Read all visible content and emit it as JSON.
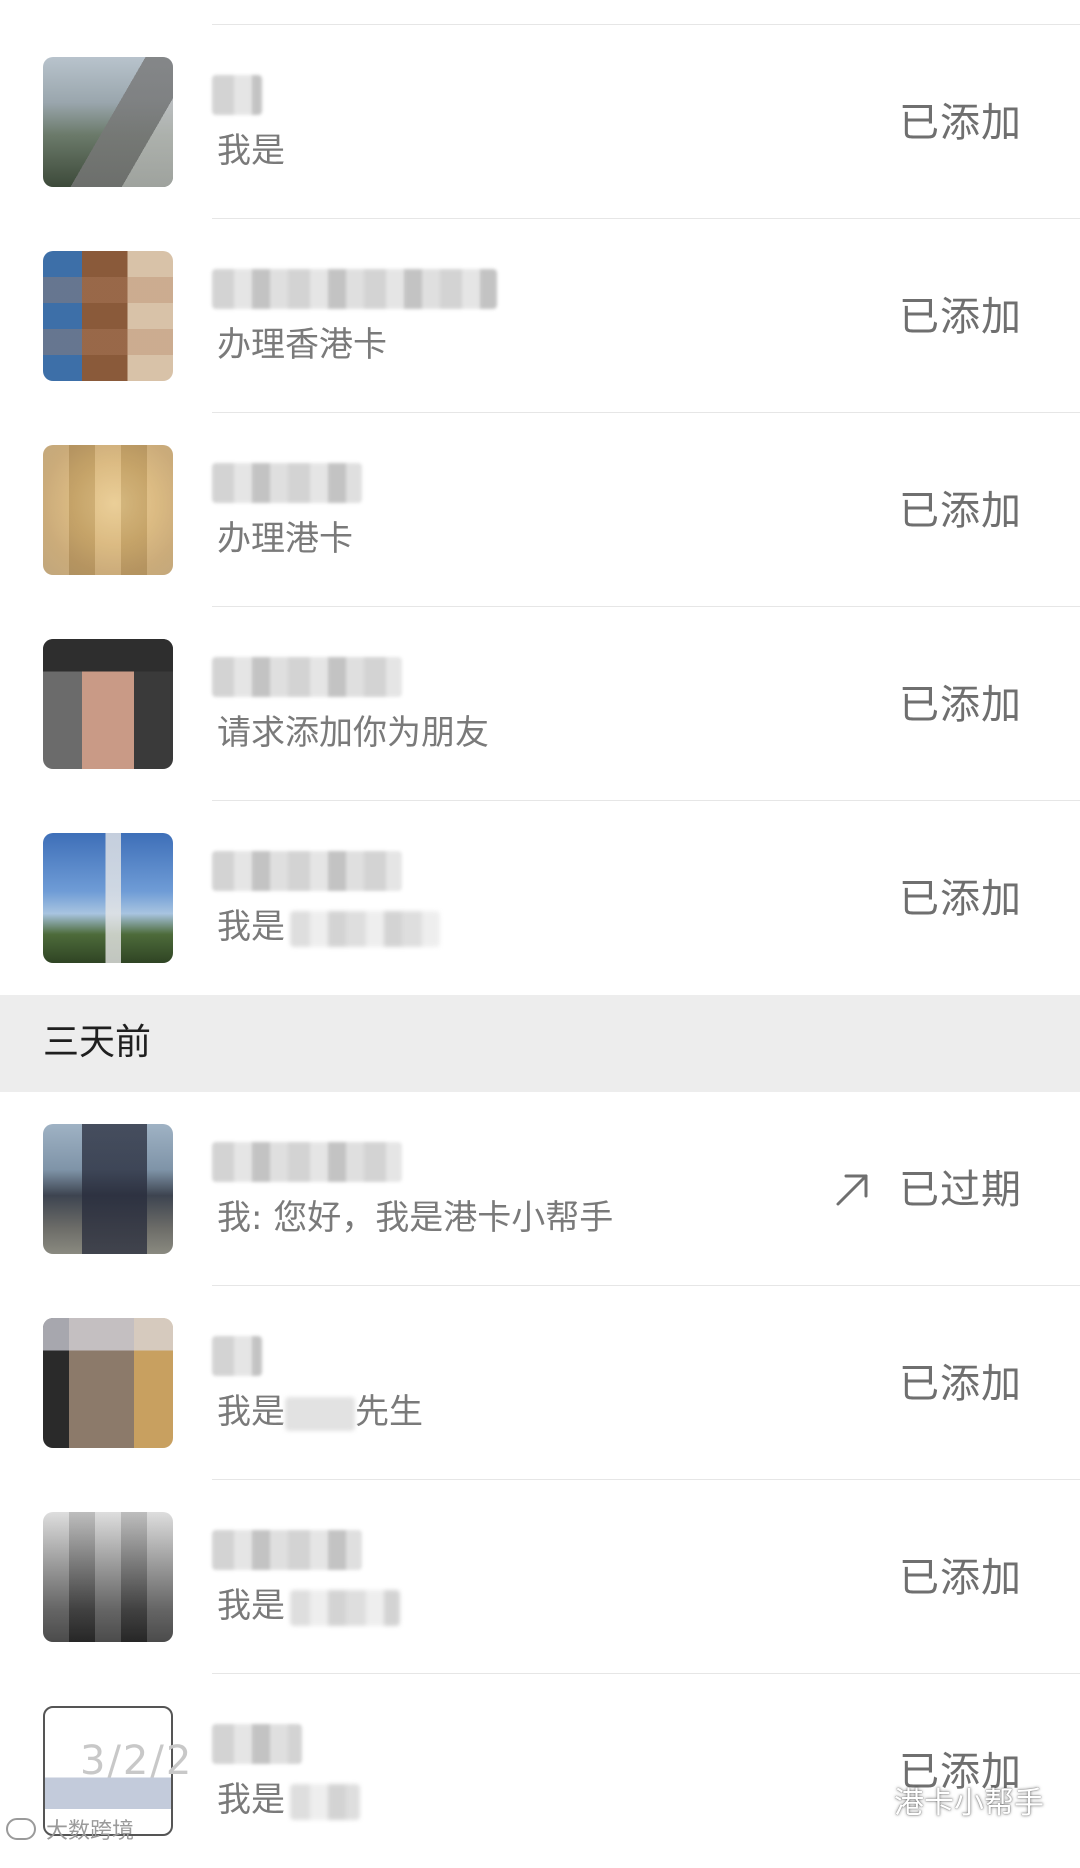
{
  "requests_recent": [
    {
      "subtitle": "我是",
      "status": "已添加",
      "name_blur_width": 50
    },
    {
      "subtitle": "办理香港卡",
      "status": "已添加",
      "name_blur_width": 285
    },
    {
      "subtitle": "办理港卡",
      "status": "已添加",
      "name_blur_width": 150
    },
    {
      "subtitle": "请求添加你为朋友",
      "status": "已添加",
      "name_blur_width": 190
    },
    {
      "subtitle": "我是",
      "status": "已添加",
      "name_blur_width": 190
    }
  ],
  "section_header": {
    "label": "三天前"
  },
  "requests_older": [
    {
      "subtitle": "我: 您好，我是港卡小帮手",
      "status": "已过期"
    },
    {
      "subtitle": "我是",
      "subtitle_suffix": "先生",
      "status": "已添加"
    },
    {
      "subtitle": "我是",
      "status": "已添加"
    },
    {
      "subtitle": "我是",
      "status": "已添加"
    }
  ],
  "icons": {
    "expired_indicator": "arrow-up-right-icon",
    "wechat_logo": "wechat-icon",
    "weibo_logo": "weibo-icon"
  },
  "watermarks": {
    "date": "3/2/2",
    "bottom_left": "大数跨境",
    "account": "港卡小帮手"
  },
  "colors": {
    "status_text": "#6f6f6f",
    "subtitle_text": "#7a7a7a",
    "section_bg": "#ededed",
    "divider": "#e6e6e6"
  }
}
